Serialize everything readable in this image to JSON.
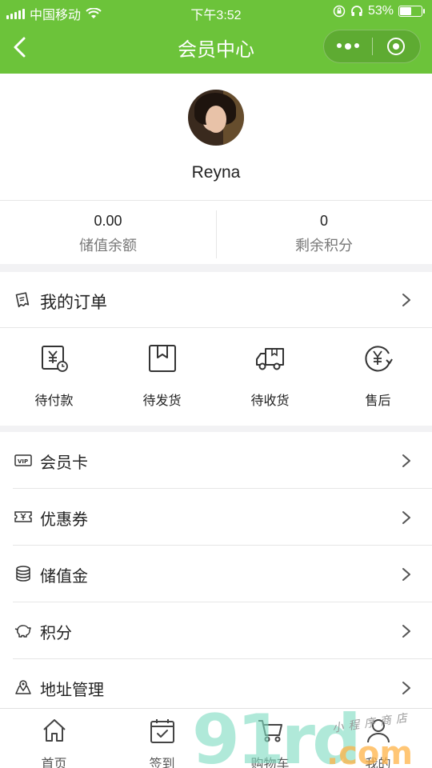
{
  "status_bar": {
    "carrier": "中国移动",
    "time": "下午3:52",
    "battery": "53%"
  },
  "nav": {
    "title": "会员中心"
  },
  "profile": {
    "username": "Reyna"
  },
  "stats": [
    {
      "value": "0.00",
      "label": "储值余额"
    },
    {
      "value": "0",
      "label": "剩余积分"
    }
  ],
  "orders": {
    "title": "我的订单",
    "items": [
      {
        "label": "待付款",
        "icon": "pending-payment-icon"
      },
      {
        "label": "待发货",
        "icon": "pending-shipment-icon"
      },
      {
        "label": "待收货",
        "icon": "delivery-truck-icon"
      },
      {
        "label": "售后",
        "icon": "refund-icon"
      }
    ]
  },
  "menu": [
    {
      "label": "会员卡",
      "icon": "vip-card-icon"
    },
    {
      "label": "优惠券",
      "icon": "coupon-icon"
    },
    {
      "label": "储值金",
      "icon": "coin-stack-icon"
    },
    {
      "label": "积分",
      "icon": "piggy-bank-icon"
    },
    {
      "label": "地址管理",
      "icon": "map-pin-icon"
    }
  ],
  "tabbar": [
    {
      "label": "首页",
      "icon": "home-icon"
    },
    {
      "label": "签到",
      "icon": "checkin-calendar-icon"
    },
    {
      "label": "购物车",
      "icon": "cart-icon"
    },
    {
      "label": "我的",
      "icon": "user-icon"
    }
  ],
  "watermark": {
    "big": "91rd",
    "com": ".com",
    "small": "小程序商店"
  },
  "colors": {
    "brand_green": "#6cc33a"
  }
}
